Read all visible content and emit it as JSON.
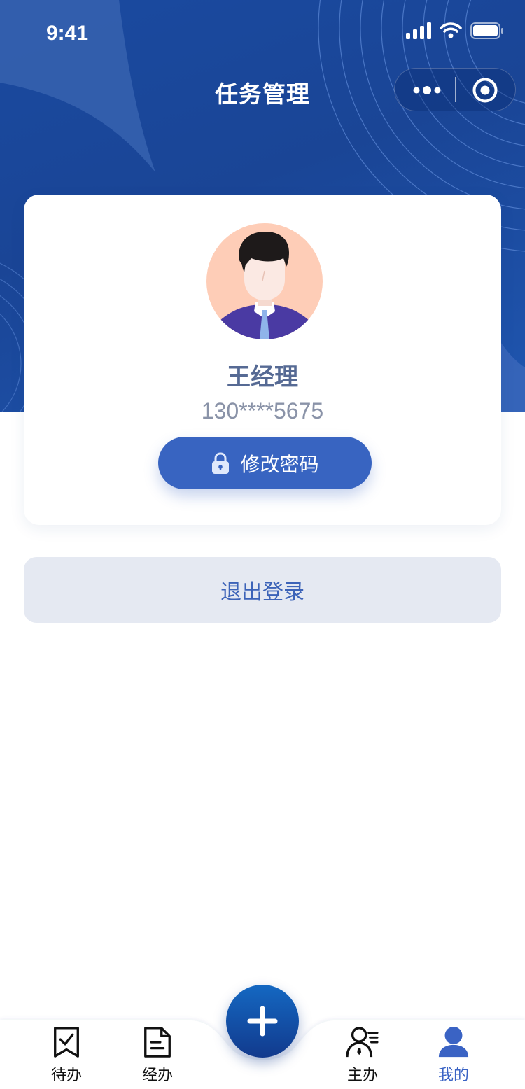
{
  "status_bar": {
    "time": "9:41"
  },
  "nav": {
    "title": "任务管理"
  },
  "profile": {
    "name": "王经理",
    "phone": "130****5675",
    "change_password_label": "修改密码"
  },
  "logout_label": "退出登录",
  "tabbar": {
    "items": [
      {
        "label": "待办",
        "icon": "bookmark-check-icon"
      },
      {
        "label": "经办",
        "icon": "document-icon"
      },
      {
        "label": "主办",
        "icon": "person-list-icon"
      },
      {
        "label": "我的",
        "icon": "user-icon",
        "active": true
      }
    ],
    "fab_icon": "plus-icon"
  },
  "colors": {
    "header_blue": "#1a4596",
    "accent": "#3864c1",
    "active_tab": "#3a63c4",
    "logout_bg": "#e5e9f2"
  }
}
